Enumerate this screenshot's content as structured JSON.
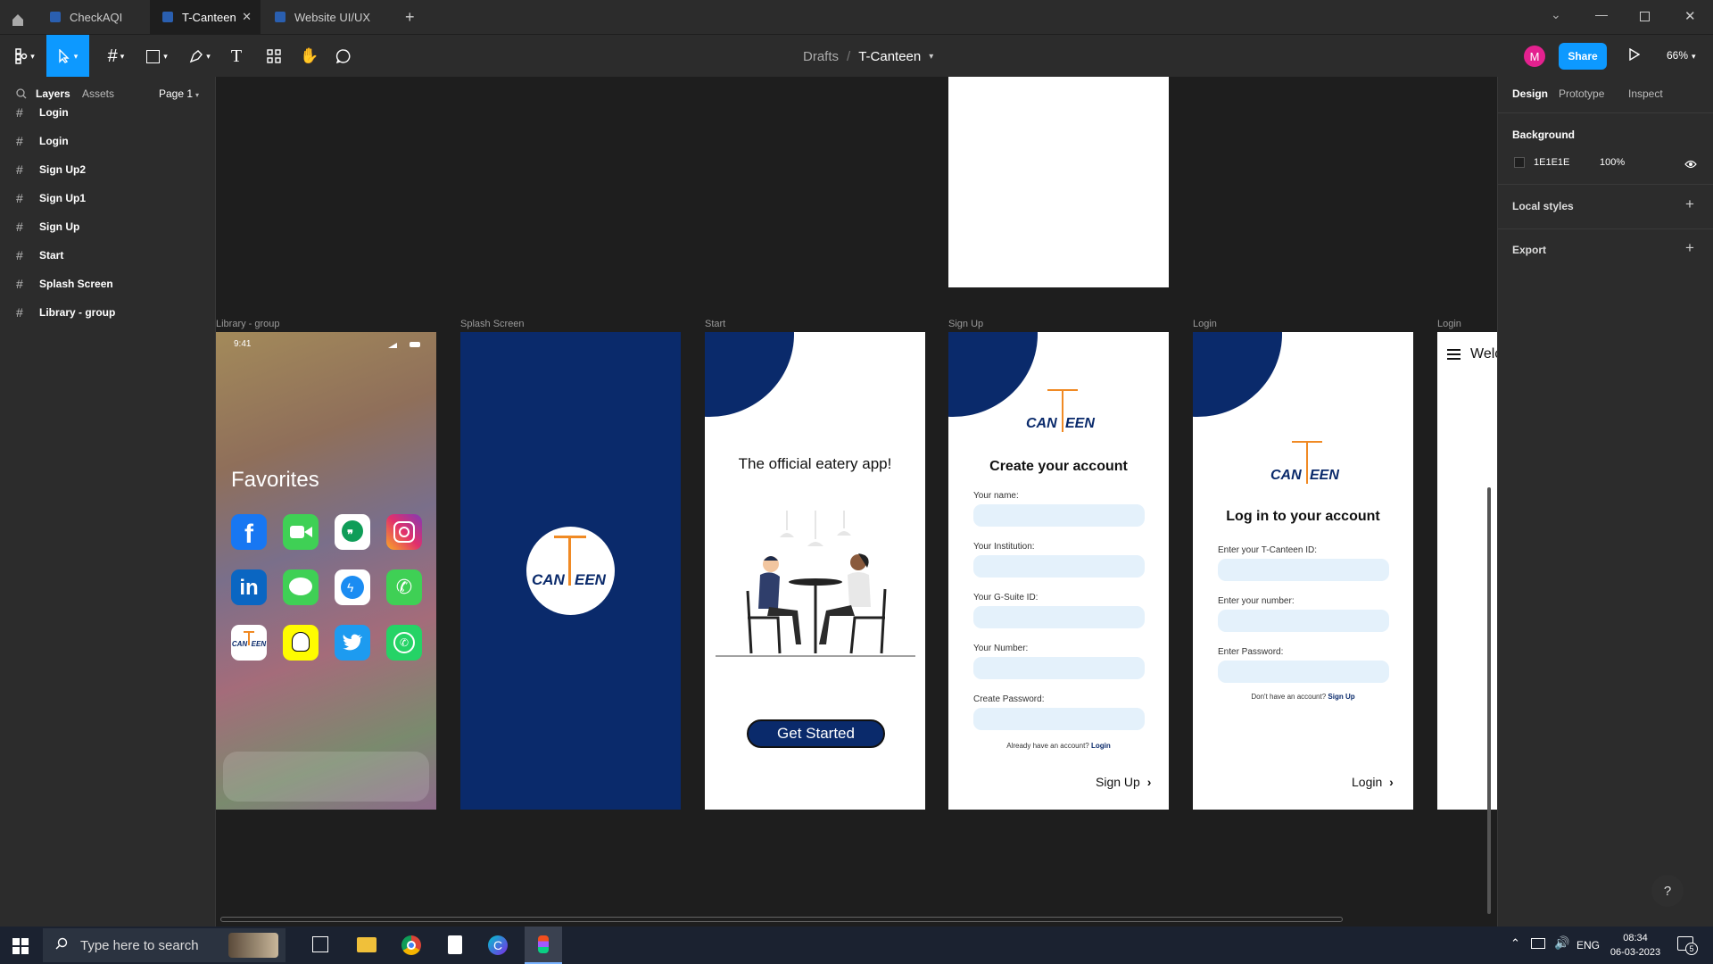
{
  "tabs": [
    {
      "label": "CheckAQI"
    },
    {
      "label": "T-Canteen"
    },
    {
      "label": "Website UI/UX"
    }
  ],
  "toolbar": {
    "breadcrumb_parent": "Drafts",
    "breadcrumb_sep": "/",
    "file_name": "T-Canteen",
    "avatar_initial": "M",
    "share_label": "Share",
    "zoom": "66%"
  },
  "left_panel": {
    "tab_layers": "Layers",
    "tab_assets": "Assets",
    "page": "Page 1",
    "layers": [
      "Login",
      "Login",
      "Sign Up2",
      "Sign Up1",
      "Sign Up",
      "Start",
      "Splash Screen",
      "Library - group"
    ]
  },
  "right_panel": {
    "tab_design": "Design",
    "tab_prototype": "Prototype",
    "tab_inspect": "Inspect",
    "background_title": "Background",
    "background_hex": "1E1E1E",
    "background_opacity": "100%",
    "local_styles": "Local styles",
    "export": "Export"
  },
  "frames": {
    "library": {
      "label": "Library - group",
      "time": "9:41",
      "favorites": "Favorites"
    },
    "splash": {
      "label": "Splash Screen"
    },
    "start": {
      "label": "Start",
      "tagline": "The official eatery app!",
      "cta": "Get Started"
    },
    "signup": {
      "label": "Sign Up",
      "title": "Create your account",
      "fields": [
        "Your name:",
        "Your Institution:",
        "Your G-Suite ID:",
        "Your Number:",
        "Create Password:"
      ],
      "have_account": "Already have an account?",
      "login_link": "Login",
      "submit": "Sign Up"
    },
    "login": {
      "label": "Login",
      "title": "Log in to your account",
      "fields": [
        "Enter your T-Canteen ID:",
        "Enter your number:",
        "Enter Password:"
      ],
      "no_account": "Don't have an account?",
      "signup_link": "Sign Up",
      "submit": "Login"
    },
    "login2": {
      "label": "Login",
      "welcome": "Welc"
    }
  },
  "logo": {
    "left": "CAN",
    "right": "EEN"
  },
  "taskbar": {
    "search_placeholder": "Type here to search",
    "lang": "ENG",
    "time": "08:34",
    "date": "06-03-2023",
    "notif_count": "5"
  },
  "help": "?",
  "colors": {
    "navy": "#0a2a6b",
    "orange": "#f08a24",
    "share": "#0d99ff",
    "accent": "#1779d6"
  }
}
